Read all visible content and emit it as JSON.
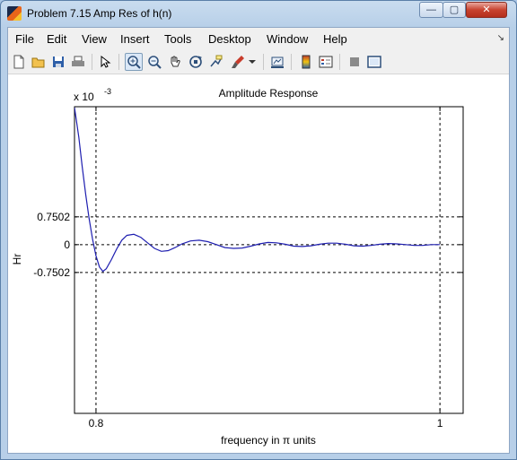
{
  "window": {
    "title": "Problem 7.15 Amp Res of h(n)",
    "controls": {
      "minimize": "—",
      "maximize": "▢",
      "close": "✕"
    }
  },
  "menu": {
    "items": [
      "File",
      "Edit",
      "View",
      "Insert",
      "Tools",
      "Desktop",
      "Window",
      "Help"
    ],
    "dock_glyph": "↘"
  },
  "toolbar": {
    "buttons": [
      "new-figure-icon",
      "open-file-icon",
      "save-icon",
      "print-icon",
      "edit-plot-arrow-icon",
      "zoom-in-icon",
      "zoom-out-icon",
      "pan-hand-icon",
      "rotate-3d-icon",
      "data-cursor-icon",
      "brush-icon",
      "link-plot-icon",
      "colorbar-icon",
      "legend-icon",
      "hide-plot-tools-icon",
      "show-plot-tools-icon"
    ],
    "active": "zoom-in-icon"
  },
  "colors": {
    "curve": "#1f1fb0",
    "frame": "#000000",
    "window_chrome": "#b7cfe8"
  },
  "chart_data": {
    "type": "line",
    "title": "Amplitude Response",
    "xlabel": "frequency in π units",
    "ylabel": "Hr",
    "exponent_label": "x 10",
    "exponent_sup": "-3",
    "xlim": [
      0.7875,
      1.0135
    ],
    "ylim": [
      -0.00455,
      0.00372
    ],
    "xticks": [
      0.8,
      1
    ],
    "xtick_labels": [
      "0.8",
      "1"
    ],
    "yticks": [
      0.0007502,
      0,
      -0.0007502
    ],
    "ytick_labels": [
      "0.7502",
      "0",
      "-0.7502"
    ],
    "grid": "dashed at ticks",
    "series": [
      {
        "x": [
          0.7875,
          0.79,
          0.792,
          0.794,
          0.796,
          0.798,
          0.8,
          0.802,
          0.804,
          0.806,
          0.809,
          0.812,
          0.815,
          0.818,
          0.822,
          0.826,
          0.83,
          0.834,
          0.838,
          0.842,
          0.846,
          0.85,
          0.855,
          0.86,
          0.865,
          0.87,
          0.875,
          0.88,
          0.885,
          0.89,
          0.895,
          0.9,
          0.905,
          0.91,
          0.915,
          0.92,
          0.925,
          0.93,
          0.935,
          0.94,
          0.945,
          0.95,
          0.955,
          0.96,
          0.965,
          0.97,
          0.975,
          0.98,
          0.985,
          0.99,
          0.995,
          1.0
        ],
        "y": [
          0.0037,
          0.0029,
          0.0021,
          0.00135,
          0.0007,
          0.00015,
          -0.0003,
          -0.0006,
          -0.00072,
          -0.00065,
          -0.0004,
          -0.00012,
          0.00012,
          0.00025,
          0.00028,
          0.0002,
          5e-05,
          -0.0001,
          -0.00018,
          -0.00016,
          -8e-05,
          2e-05,
          0.0001,
          0.00012,
          8e-05,
          0.0,
          -8e-05,
          -0.0001,
          -9e-05,
          -4e-05,
          2e-05,
          6e-05,
          5e-05,
          1e-05,
          -4e-05,
          -5e-05,
          -3e-05,
          1e-05,
          4e-05,
          4e-05,
          1e-05,
          -3e-05,
          -4e-05,
          -2e-05,
          1e-05,
          3e-05,
          2e-05,
          0.0,
          -2e-05,
          -2e-05,
          0.0,
          0.0
        ]
      }
    ]
  }
}
